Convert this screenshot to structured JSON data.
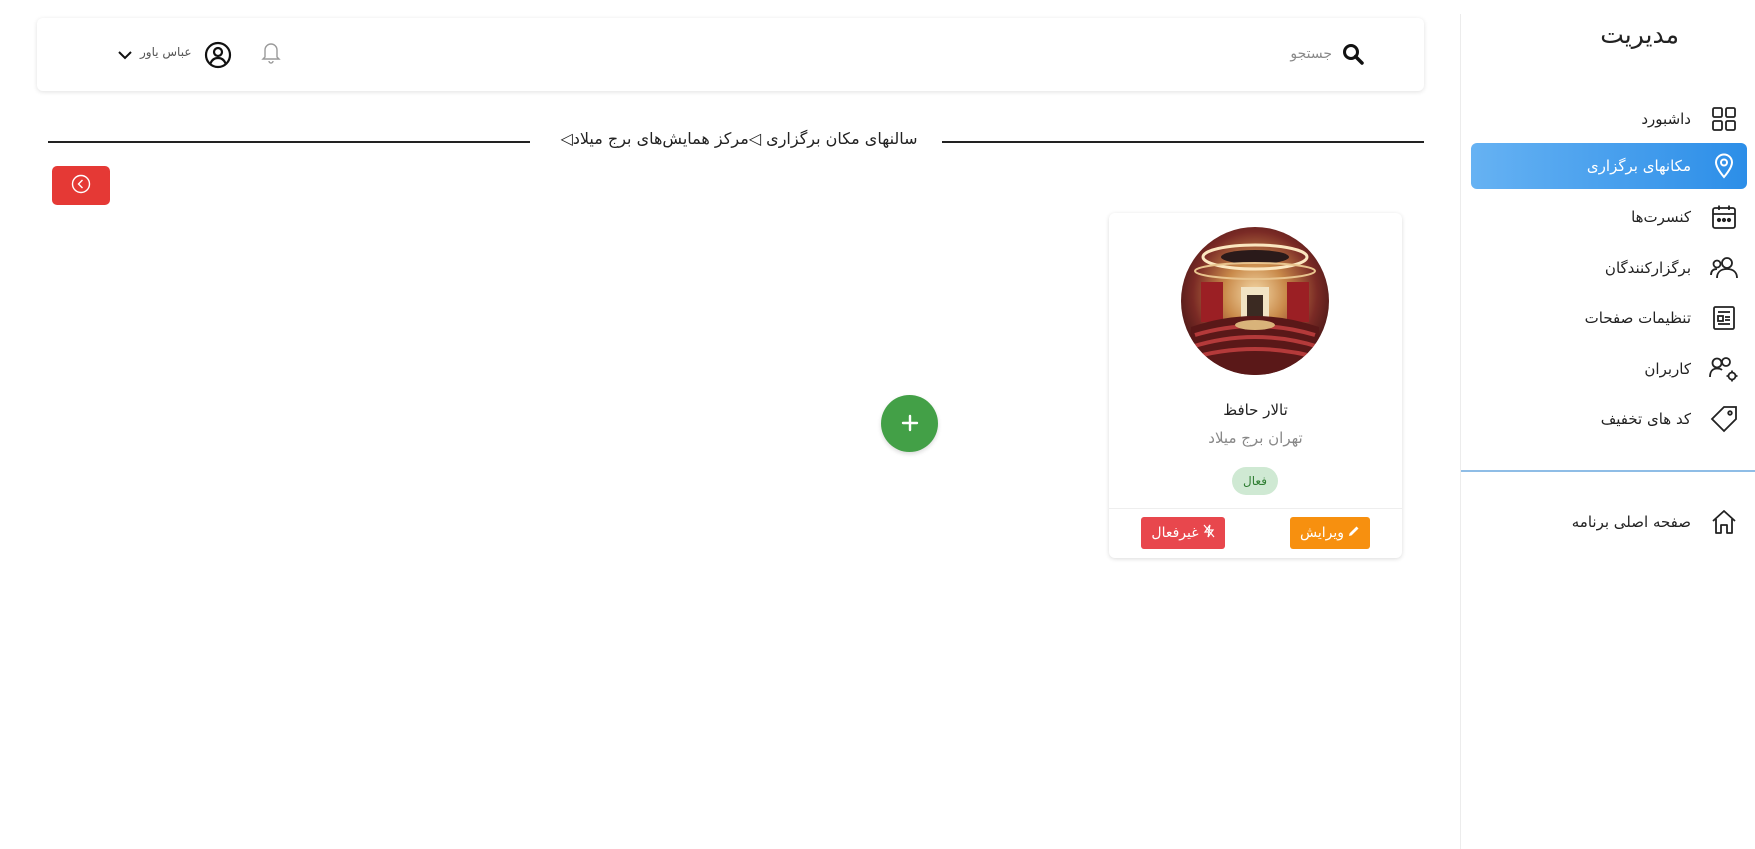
{
  "sidebar": {
    "title": "مدیریت",
    "items": [
      {
        "label": "داشبورد",
        "icon": "dashboard-grid-icon"
      },
      {
        "label": "مکانهای برگزاری",
        "icon": "location-pin-icon",
        "active": true
      },
      {
        "label": "کنسرت‌ها",
        "icon": "calendar-icon"
      },
      {
        "label": "برگزارکنندگان",
        "icon": "organizers-icon"
      },
      {
        "label": "تنظیمات صفحات",
        "icon": "page-settings-icon"
      },
      {
        "label": "کاربران",
        "icon": "users-gear-icon"
      },
      {
        "label": "کد های تخفیف",
        "icon": "tag-icon"
      }
    ],
    "home_label": "صفحه اصلی برنامه"
  },
  "header": {
    "search_placeholder": "جستجو",
    "user_name": "عباس یاور"
  },
  "page": {
    "title": "سالنهای مکان برگزاری ◁مرکز همایش‌های برج میلاد◁"
  },
  "card": {
    "name": "تالار حافظ",
    "location": "تهران برج میلاد",
    "status": "فعال",
    "edit_label": "ویرایش",
    "disable_label": "غیرفعال"
  },
  "colors": {
    "accent_blue": "#2c8ee8",
    "danger_red": "#e53935",
    "success_green": "#43a047",
    "edit_orange": "#f7900f"
  }
}
